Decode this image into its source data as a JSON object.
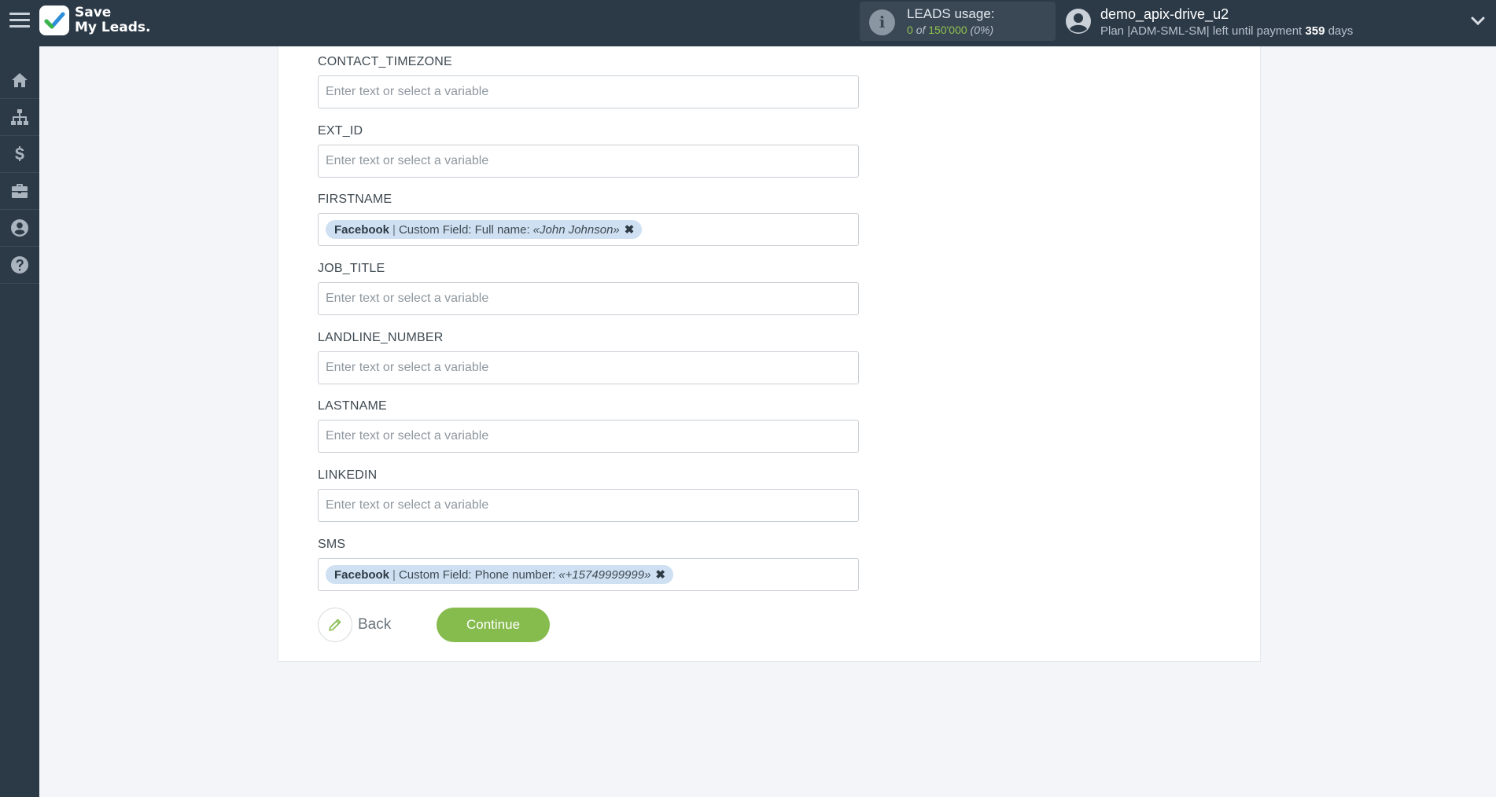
{
  "app": {
    "logo_line1": "Save",
    "logo_line2": "My Leads."
  },
  "leads": {
    "title": "LEADS usage:",
    "used": "0",
    "of_label": "of",
    "limit": "150'000",
    "percent": "(0%)"
  },
  "user": {
    "name": "demo_apix-drive_u2",
    "plan_prefix": "Plan |ADM-SML-SM| left until payment ",
    "days_count": "359",
    "days_suffix": " days"
  },
  "sidebar": {
    "items": [
      {
        "icon": "home-icon"
      },
      {
        "icon": "sitemap-icon"
      },
      {
        "icon": "dollar-icon"
      },
      {
        "icon": "briefcase-icon"
      },
      {
        "icon": "user-circle-icon"
      },
      {
        "icon": "question-circle-icon"
      }
    ]
  },
  "form": {
    "placeholder": "Enter text or select a variable",
    "fields": [
      {
        "label": "CONTACT_TIMEZONE",
        "value": ""
      },
      {
        "label": "EXT_ID",
        "value": ""
      },
      {
        "label": "FIRSTNAME",
        "tag": {
          "source": "Facebook",
          "separator": "|",
          "field": "Custom Field: Full name:",
          "value": "«John Johnson»"
        }
      },
      {
        "label": "JOB_TITLE",
        "value": ""
      },
      {
        "label": "LANDLINE_NUMBER",
        "value": ""
      },
      {
        "label": "LASTNAME",
        "value": ""
      },
      {
        "label": "LINKEDIN",
        "value": ""
      },
      {
        "label": "SMS",
        "tag": {
          "source": "Facebook",
          "separator": "|",
          "field": "Custom Field: Phone number:",
          "value": "«+15749999999»"
        }
      }
    ],
    "back_label": "Back",
    "continue_label": "Continue"
  },
  "colors": {
    "topbar": "#2c3a48",
    "accent_green": "#86bb4e",
    "tag_bg": "#cfe0f2"
  }
}
